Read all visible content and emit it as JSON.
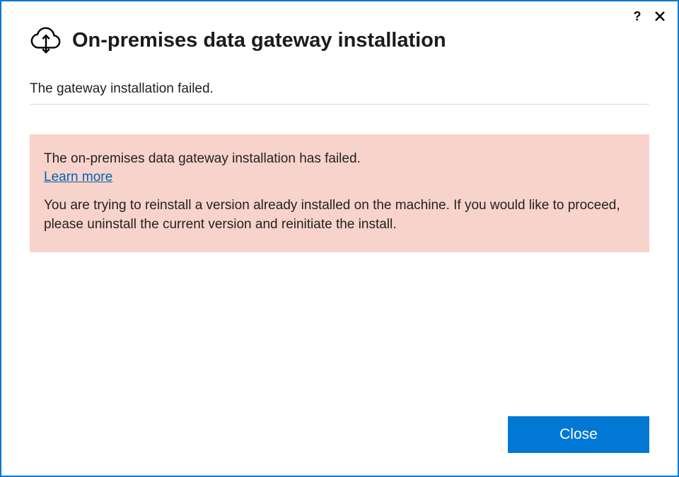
{
  "header": {
    "title": "On-premises data gateway installation"
  },
  "status": {
    "text": "The gateway installation failed."
  },
  "error": {
    "message": "The on-premises data gateway installation has failed.",
    "learn_more_label": "Learn more",
    "detail": "You are trying to reinstall a version already installed on the machine. If you would like to proceed, please uninstall the current version and reinitiate the install."
  },
  "footer": {
    "close_label": "Close"
  },
  "titlebar": {
    "help_label": "?"
  }
}
